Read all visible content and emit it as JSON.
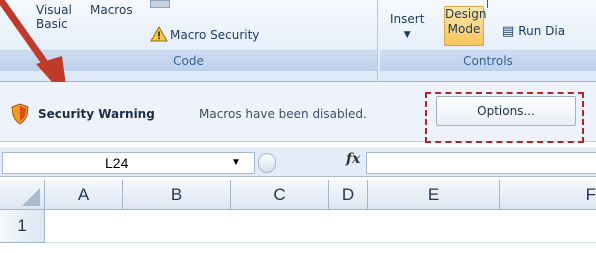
{
  "ribbon": {
    "visual_basic": "Visual\nBasic",
    "macros": "Macros",
    "macro_security": "Macro Security",
    "code_group": "Code",
    "insert": "Insert",
    "design_mode": "Design\nMode",
    "run_dialog": "Run Dia",
    "controls_group": "Controls"
  },
  "security_bar": {
    "title": "Security Warning",
    "message": "Macros have been disabled.",
    "options_button": "Options..."
  },
  "formula_bar": {
    "name_box": "L24",
    "fx": "fx",
    "formula": ""
  },
  "grid": {
    "columns": [
      "A",
      "B",
      "C",
      "D",
      "E",
      "F"
    ],
    "rows": [
      "1"
    ]
  },
  "colors": {
    "warning": "#b2232a",
    "accent": "#f7c559"
  }
}
